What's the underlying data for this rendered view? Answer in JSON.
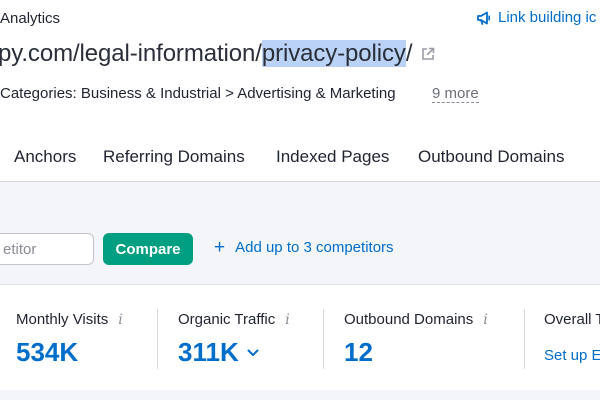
{
  "header": {
    "breadcrumb": "Analytics",
    "link_building": "Link building ic",
    "url_before": "py.com/legal-information/",
    "url_highlight": "privacy-policy",
    "url_after": "/",
    "categories": "Categories: Business & Industrial > Advertising & Marketing",
    "more": "9 more"
  },
  "tabs": [
    "Anchors",
    "Referring Domains",
    "Indexed Pages",
    "Outbound Domains"
  ],
  "competitors": {
    "placeholder": "etitor",
    "compare_label": "Compare",
    "add_label": "Add up to 3 competitors"
  },
  "metrics": [
    {
      "label": "Monthly Visits",
      "value": "534K",
      "info": "i"
    },
    {
      "label": "Organic Traffic",
      "value": "311K",
      "info": "i"
    },
    {
      "label": "Outbound Domains",
      "value": "12",
      "info": "i"
    },
    {
      "label": "Overall T",
      "link": "Set up E"
    }
  ],
  "colors": {
    "accent_blue": "#006dca",
    "compare_green": "#009f81",
    "highlight": "#b9d2f5",
    "background_gray": "#f4f5f9"
  },
  "icons": {
    "link_building": "megaphone-icon",
    "external": "external-link-icon",
    "dropdown": "chevron-down-icon",
    "add": "plus-icon"
  }
}
